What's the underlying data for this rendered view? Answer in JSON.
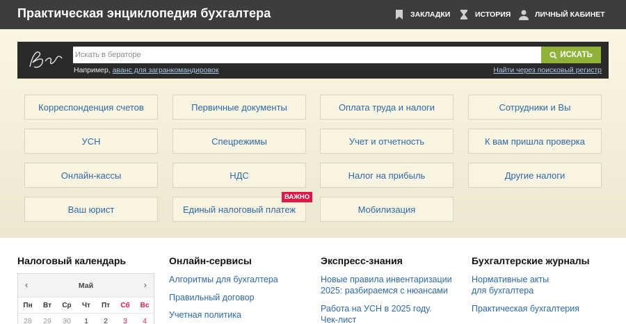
{
  "header": {
    "title": "Практическая энциклопедия бухгалтера",
    "nav": [
      {
        "label": "ЗАКЛАДКИ",
        "icon": "bookmark-icon"
      },
      {
        "label": "ИСТОРИЯ",
        "icon": "hourglass-icon"
      },
      {
        "label": "ЛИЧНЫЙ КАБИНЕТ",
        "icon": "user-icon"
      }
    ]
  },
  "search": {
    "logo_text": "Бератор",
    "placeholder": "Искать в бераторе",
    "button_label": "ИСКАТЬ",
    "example_prefix": "Например,",
    "example_link": "аванс для загранкомандировок",
    "registry_link": "Найти через поисковый регистр"
  },
  "categories": [
    "Корреспонденция счетов",
    "Первичные документы",
    "Оплата труда и налоги",
    "Сотрудники и Вы",
    "УСН",
    "Спецрежимы",
    "Учет и отчетность",
    "К вам пришла проверка",
    "Онлайн-кассы",
    "НДС",
    "Налог на прибыль",
    "Другие налоги",
    "Ваш юрист",
    "Единый налоговый платеж",
    "Мобилизация"
  ],
  "important_badge": "ВАЖНО",
  "columns": {
    "calendar": {
      "title": "Налоговый календарь",
      "month": "Май",
      "weekdays": [
        "Пн",
        "Вт",
        "Ср",
        "Чт",
        "Пт",
        "Сб",
        "Вс"
      ],
      "first_row": [
        "28",
        "29",
        "30",
        "1",
        "2",
        "3",
        "4"
      ]
    },
    "services": {
      "title": "Онлайн-сервисы",
      "links": [
        "Алгоритмы для бухгалтера",
        "Правильный договор",
        "Учетная политика"
      ]
    },
    "express": {
      "title": "Экспресс-знания",
      "links": [
        [
          "Новые правила инвентаризации",
          "2025: разбираемся с нюансами"
        ],
        [
          "Работа на УСН в 2025 году.",
          "Чек-лист"
        ]
      ]
    },
    "journals": {
      "title": "Бухгалтерские журналы",
      "links": [
        [
          "Нормативные акты",
          "для бухгалтера"
        ],
        [
          "Практическая бухгалтерия"
        ]
      ]
    }
  },
  "colors": {
    "topbar": "#3d3d3d",
    "link": "#2e6aa8",
    "search_button": "#8fb339",
    "badge": "#e0184a",
    "weekend": "#e0184a"
  }
}
